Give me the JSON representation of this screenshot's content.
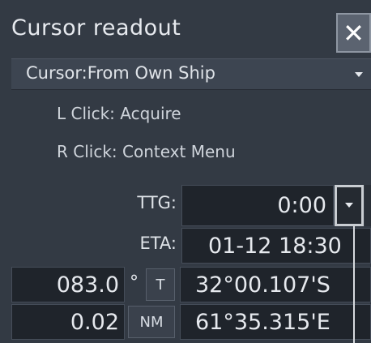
{
  "window": {
    "title": "Cursor readout",
    "close_glyph": "✕"
  },
  "cursor_mode": {
    "label": "Cursor:From Own Ship"
  },
  "hints": {
    "left_click": "L Click: Acquire",
    "right_click": "R Click: Context Menu"
  },
  "ttg": {
    "label": "TTG:",
    "value": "0:00"
  },
  "eta": {
    "label": "ETA:",
    "value": "01-12 18:30"
  },
  "bearing": {
    "value": "083.0",
    "unit_symbol": "°",
    "reference": "T"
  },
  "latitude": {
    "value": "32°00.107'S"
  },
  "range": {
    "value": "0.02",
    "unit": "NM"
  },
  "longitude": {
    "value": "61°35.315'E"
  },
  "colors": {
    "panel_background": "#333a44",
    "value_box_background": "#1f242b",
    "text": "#e6e9ee"
  }
}
